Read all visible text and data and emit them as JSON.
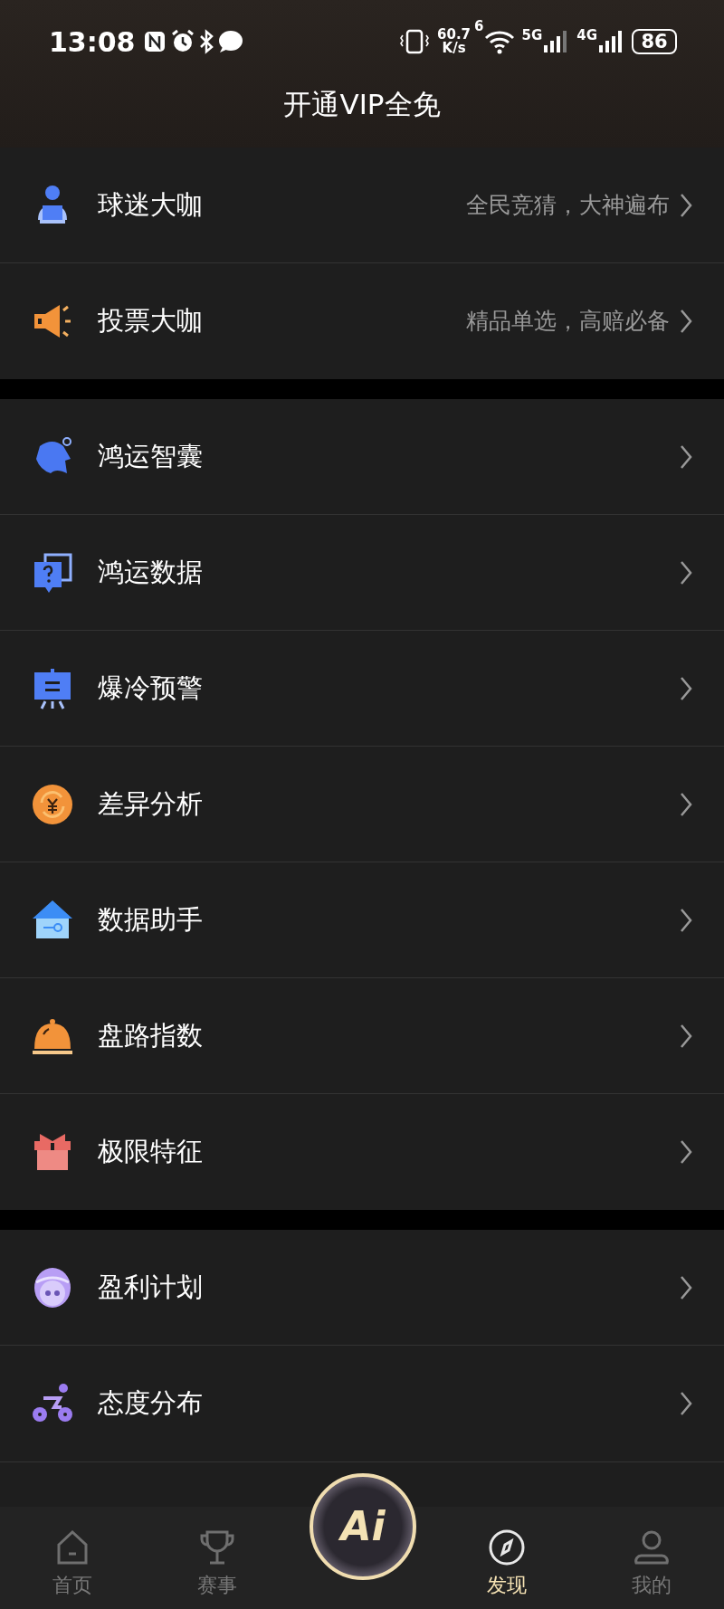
{
  "status_bar": {
    "time": "13:08",
    "net_speed": "60.7",
    "net_unit": "K/s",
    "wifi_tag": "6",
    "sim1": "5G",
    "sim2": "4G",
    "battery": "86"
  },
  "header": {
    "title": "开通VIP全免"
  },
  "groups": [
    {
      "items": [
        {
          "kind": "presenter",
          "label": "球迷大咖",
          "hint": "全民竞猜，大神遍布"
        },
        {
          "kind": "megaphone",
          "label": "投票大咖",
          "hint": "精品单选，高赔必备"
        }
      ]
    },
    {
      "items": [
        {
          "kind": "head",
          "label": "鸿运智囊"
        },
        {
          "kind": "question",
          "label": "鸿运数据"
        },
        {
          "kind": "board",
          "label": "爆冷预警"
        },
        {
          "kind": "coin",
          "label": "差异分析"
        },
        {
          "kind": "house",
          "label": "数据助手"
        },
        {
          "kind": "bell",
          "label": "盘路指数"
        },
        {
          "kind": "gift",
          "label": "极限特征"
        }
      ]
    },
    {
      "items": [
        {
          "kind": "face",
          "label": "盈利计划"
        },
        {
          "kind": "cyclist",
          "label": "态度分布"
        }
      ]
    }
  ],
  "tabs": [
    {
      "kind": "home",
      "label": "首页",
      "selected": false
    },
    {
      "kind": "trophy",
      "label": "赛事",
      "selected": false
    },
    {
      "kind": "compass",
      "label": "发现",
      "selected": true
    },
    {
      "kind": "person",
      "label": "我的",
      "selected": false
    }
  ],
  "ai_button": {
    "label": "Ai"
  }
}
